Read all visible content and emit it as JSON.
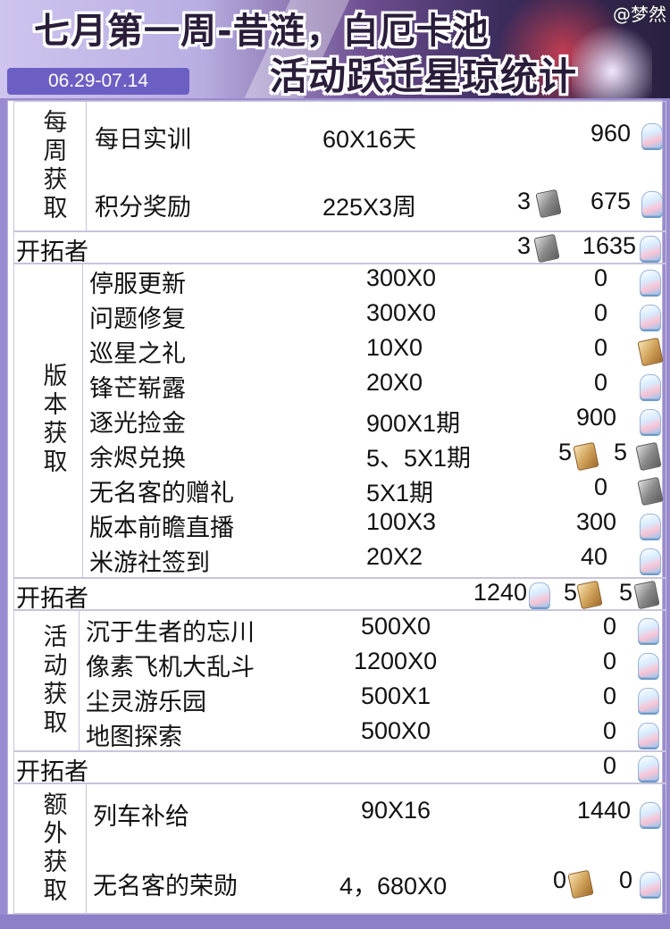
{
  "header": {
    "title_line1": "七月第一周-昔涟，白厄卡池",
    "title_line2": "活动跃迁星琼统计",
    "watermark": "@梦然",
    "date_range": "06.29-07.14"
  },
  "weekly": {
    "label": "每\n周\n获\n取",
    "rows": [
      {
        "name": "每日实训",
        "formula": "60X16天",
        "pass": "",
        "jade": "960"
      },
      {
        "name": "积分奖励",
        "formula": "225X3周",
        "pass": "3",
        "jade": "675"
      }
    ],
    "total": {
      "name": "开拓者",
      "pass": "3",
      "jade": "1635"
    }
  },
  "version": {
    "label": "版\n本\n获\n取",
    "rows": [
      {
        "name": "停服更新",
        "formula": "300X0",
        "value": "0",
        "icon": "stellar-jade-icon"
      },
      {
        "name": "问题修复",
        "formula": "300X0",
        "value": "0",
        "icon": "stellar-jade-icon"
      },
      {
        "name": "巡星之礼",
        "formula": "10X0",
        "value": "0",
        "icon": "star-rail-special-pass-icon"
      },
      {
        "name": "锋芒崭露",
        "formula": "20X0",
        "value": "0",
        "icon": "stellar-jade-icon"
      },
      {
        "name": "逐光捡金",
        "formula": "900X1期",
        "value": "900",
        "icon": "stellar-jade-icon"
      },
      {
        "name": "余烬兑换",
        "formula": "5、5X1期",
        "value_a": "5",
        "value_b": "5",
        "icon": "star-rail-pass-icon"
      },
      {
        "name": "无名客的赠礼",
        "formula": "5X1期",
        "value": "0",
        "icon": "star-rail-pass-icon"
      },
      {
        "name": "版本前瞻直播",
        "formula": "100X3",
        "value": "300",
        "icon": "stellar-jade-icon"
      },
      {
        "name": "米游社签到",
        "formula": "20X2",
        "value": "40",
        "icon": "stellar-jade-icon"
      }
    ],
    "total": {
      "name": "开拓者",
      "jade": "1240",
      "special": "5",
      "pass": "5"
    }
  },
  "event": {
    "label": "活\n动\n获\n取",
    "rows": [
      {
        "name": "沉于生者的忘川",
        "formula": "500X0",
        "value": "0"
      },
      {
        "name": "像素飞机大乱斗",
        "formula": "1200X0",
        "value": "0"
      },
      {
        "name": "尘灵游乐园",
        "formula": "500X1",
        "value": "0"
      },
      {
        "name": "地图探索",
        "formula": "500X0",
        "value": "0"
      }
    ],
    "total": {
      "name": "开拓者",
      "value": "0"
    }
  },
  "extra": {
    "label": "额\n外\n获\n取",
    "rows": [
      {
        "name": "列车补给",
        "formula": "90X16",
        "jade": "1440"
      },
      {
        "name": "无名客的荣勋",
        "formula": "4，680X0",
        "special": "0",
        "jade": "0"
      }
    ]
  },
  "colors": {
    "accent": "#6c5fc4",
    "background": "#9a8ad0",
    "text": "#111111"
  }
}
